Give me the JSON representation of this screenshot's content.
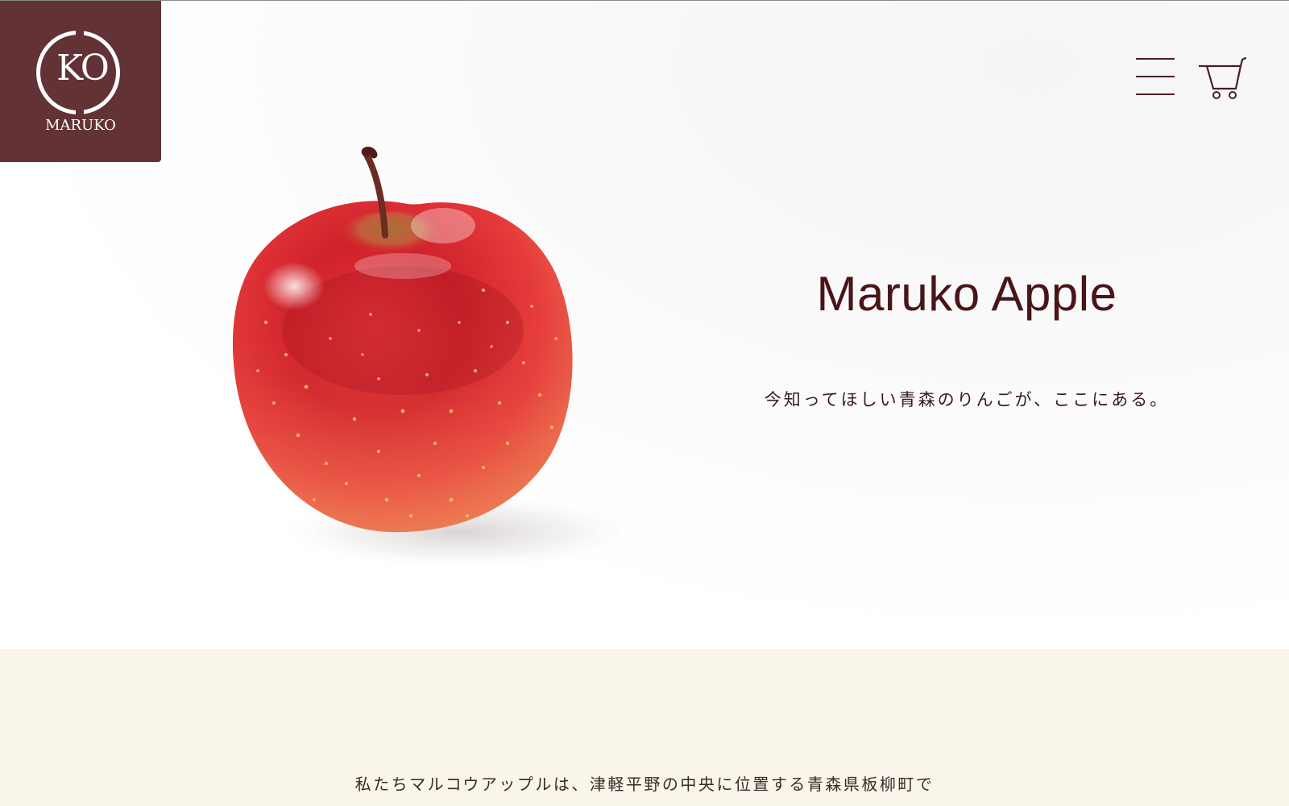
{
  "header": {
    "logo_mark": "KO",
    "logo_word": "MARUKO",
    "menu_icon": "hamburger-menu-icon",
    "cart_icon": "shopping-cart-icon"
  },
  "hero": {
    "title": "Maruko Apple",
    "subtitle": "今知ってほしい青森のりんごが、ここにある。",
    "image_icon": "red-apple-image"
  },
  "intro": {
    "text": "私たちマルコウアップルは、津軽平野の中央に位置する青森県板柳町で"
  },
  "colors": {
    "brand": "#623234",
    "title": "#4a1418",
    "intro_bg": "#faf5ea"
  }
}
